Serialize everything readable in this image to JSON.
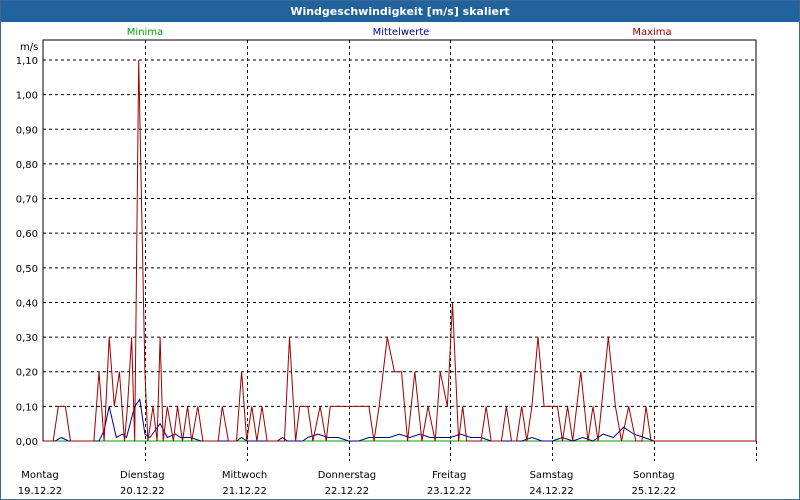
{
  "window": {
    "title": "Windgeschwindigkeit [m/s] skaliert"
  },
  "chart_data": {
    "type": "line",
    "title": "Windgeschwindigkeit [m/s] skaliert",
    "ylabel": "m/s",
    "ylim": [
      0,
      1.1
    ],
    "yticks": [
      "0,00",
      "0,10",
      "0,20",
      "0,30",
      "0,40",
      "0,50",
      "0,60",
      "0,70",
      "0,80",
      "0,90",
      "1,00",
      "1,10"
    ],
    "xlim": [
      0,
      7
    ],
    "day_labels": [
      {
        "day": "Montag",
        "date": "19.12.22"
      },
      {
        "day": "Dienstag",
        "date": "20.12.22"
      },
      {
        "day": "Mittwoch",
        "date": "21.12.22"
      },
      {
        "day": "Donnerstag",
        "date": "22.12.22"
      },
      {
        "day": "Freitag",
        "date": "23.12.22"
      },
      {
        "day": "Samstag",
        "date": "24.12.22"
      },
      {
        "day": "Sonntag",
        "date": "25.12.22"
      }
    ],
    "grid": true,
    "legend": [
      "Minima",
      "Mittelwerte",
      "Maxima"
    ],
    "series": [
      {
        "name": "Minima",
        "color": "#00a000",
        "points": [
          [
            0,
            0
          ],
          [
            7,
            0
          ]
        ]
      },
      {
        "name": "Mittelwerte",
        "color": "#000090",
        "points": [
          [
            0,
            0
          ],
          [
            0.12,
            0
          ],
          [
            0.18,
            0.01
          ],
          [
            0.25,
            0
          ],
          [
            0.55,
            0
          ],
          [
            0.6,
            0.03
          ],
          [
            0.65,
            0.1
          ],
          [
            0.72,
            0.01
          ],
          [
            0.78,
            0.02
          ],
          [
            0.82,
            0.01
          ],
          [
            0.9,
            0.1
          ],
          [
            0.95,
            0.12
          ],
          [
            1.0,
            0.02
          ],
          [
            1.05,
            0.01
          ],
          [
            1.15,
            0.05
          ],
          [
            1.22,
            0.01
          ],
          [
            1.3,
            0.02
          ],
          [
            1.35,
            0.01
          ],
          [
            1.45,
            0.01
          ],
          [
            1.55,
            0
          ],
          [
            1.9,
            0
          ],
          [
            1.95,
            0.01
          ],
          [
            2.0,
            0
          ],
          [
            2.3,
            0
          ],
          [
            2.35,
            0.01
          ],
          [
            2.4,
            0
          ],
          [
            2.55,
            0
          ],
          [
            2.6,
            0.01
          ],
          [
            2.7,
            0.02
          ],
          [
            2.8,
            0.01
          ],
          [
            2.9,
            0.01
          ],
          [
            3.0,
            0
          ],
          [
            3.1,
            0
          ],
          [
            3.2,
            0.01
          ],
          [
            3.3,
            0.01
          ],
          [
            3.4,
            0.01
          ],
          [
            3.5,
            0.02
          ],
          [
            3.6,
            0.01
          ],
          [
            3.7,
            0.02
          ],
          [
            3.8,
            0.01
          ],
          [
            3.9,
            0.01
          ],
          [
            4.0,
            0.01
          ],
          [
            4.1,
            0.02
          ],
          [
            4.2,
            0.01
          ],
          [
            4.3,
            0.01
          ],
          [
            4.4,
            0
          ],
          [
            4.5,
            0
          ],
          [
            4.7,
            0
          ],
          [
            4.8,
            0.01
          ],
          [
            4.9,
            0
          ],
          [
            5.0,
            0
          ],
          [
            5.1,
            0.01
          ],
          [
            5.2,
            0
          ],
          [
            5.3,
            0.01
          ],
          [
            5.4,
            0
          ],
          [
            5.5,
            0.02
          ],
          [
            5.6,
            0.01
          ],
          [
            5.7,
            0.04
          ],
          [
            5.8,
            0.02
          ],
          [
            5.9,
            0.01
          ],
          [
            6.0,
            0
          ],
          [
            6.1,
            0
          ],
          [
            7,
            0
          ]
        ]
      },
      {
        "name": "Maxima",
        "color": "#a00000",
        "points": [
          [
            0,
            0
          ],
          [
            0.1,
            0
          ],
          [
            0.15,
            0.1
          ],
          [
            0.22,
            0.1
          ],
          [
            0.27,
            0
          ],
          [
            0.5,
            0
          ],
          [
            0.55,
            0.2
          ],
          [
            0.6,
            0
          ],
          [
            0.65,
            0.3
          ],
          [
            0.7,
            0.1
          ],
          [
            0.75,
            0.2
          ],
          [
            0.8,
            0
          ],
          [
            0.83,
            0.1
          ],
          [
            0.87,
            0.3
          ],
          [
            0.9,
            0
          ],
          [
            0.94,
            1.1
          ],
          [
            1.0,
            0.2
          ],
          [
            1.03,
            0
          ],
          [
            1.08,
            0.1
          ],
          [
            1.12,
            0
          ],
          [
            1.15,
            0.3
          ],
          [
            1.18,
            0
          ],
          [
            1.22,
            0.1
          ],
          [
            1.28,
            0
          ],
          [
            1.32,
            0.1
          ],
          [
            1.37,
            0
          ],
          [
            1.42,
            0.1
          ],
          [
            1.46,
            0
          ],
          [
            1.52,
            0.1
          ],
          [
            1.57,
            0
          ],
          [
            1.62,
            0
          ],
          [
            1.72,
            0
          ],
          [
            1.76,
            0.1
          ],
          [
            1.82,
            0
          ],
          [
            1.9,
            0
          ],
          [
            1.95,
            0.2
          ],
          [
            2.0,
            0
          ],
          [
            2.05,
            0.1
          ],
          [
            2.1,
            0
          ],
          [
            2.15,
            0.1
          ],
          [
            2.2,
            0
          ],
          [
            2.3,
            0
          ],
          [
            2.37,
            0
          ],
          [
            2.42,
            0.3
          ],
          [
            2.48,
            0
          ],
          [
            2.52,
            0.1
          ],
          [
            2.6,
            0.1
          ],
          [
            2.65,
            0
          ],
          [
            2.72,
            0.1
          ],
          [
            2.78,
            0
          ],
          [
            2.82,
            0.1
          ],
          [
            3.2,
            0.1
          ],
          [
            3.25,
            0
          ],
          [
            3.3,
            0.1
          ],
          [
            3.38,
            0.3
          ],
          [
            3.45,
            0.2
          ],
          [
            3.52,
            0.2
          ],
          [
            3.58,
            0
          ],
          [
            3.65,
            0.2
          ],
          [
            3.72,
            0
          ],
          [
            3.78,
            0.1
          ],
          [
            3.85,
            0
          ],
          [
            3.9,
            0.2
          ],
          [
            3.97,
            0.1
          ],
          [
            4.02,
            0.4
          ],
          [
            4.08,
            0
          ],
          [
            4.12,
            0.1
          ],
          [
            4.16,
            0
          ],
          [
            4.3,
            0
          ],
          [
            4.35,
            0.1
          ],
          [
            4.4,
            0
          ],
          [
            4.5,
            0
          ],
          [
            4.55,
            0.1
          ],
          [
            4.6,
            0
          ],
          [
            4.65,
            0
          ],
          [
            4.7,
            0.1
          ],
          [
            4.75,
            0
          ],
          [
            4.8,
            0.1
          ],
          [
            4.86,
            0.3
          ],
          [
            4.92,
            0.1
          ],
          [
            5.05,
            0.1
          ],
          [
            5.1,
            0
          ],
          [
            5.15,
            0.1
          ],
          [
            5.2,
            0
          ],
          [
            5.28,
            0.2
          ],
          [
            5.35,
            0
          ],
          [
            5.4,
            0.1
          ],
          [
            5.45,
            0
          ],
          [
            5.55,
            0.3
          ],
          [
            5.62,
            0.1
          ],
          [
            5.68,
            0
          ],
          [
            5.75,
            0.1
          ],
          [
            5.82,
            0
          ],
          [
            5.88,
            0
          ],
          [
            5.92,
            0.1
          ],
          [
            5.97,
            0
          ],
          [
            6.1,
            0
          ],
          [
            7,
            0
          ]
        ]
      }
    ]
  }
}
